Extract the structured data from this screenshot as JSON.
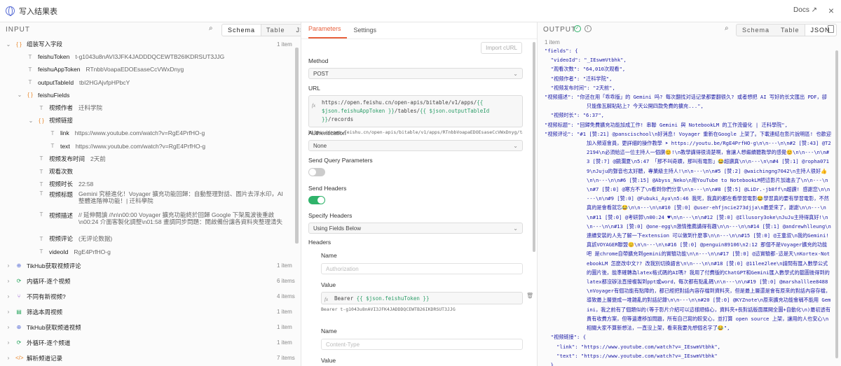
{
  "window": {
    "title": "写入结果表",
    "docs_label": "Docs ↗",
    "close_label": "×"
  },
  "input": {
    "header": "INPUT",
    "views": [
      "Schema",
      "Table",
      "JSON"
    ],
    "active_view": "Schema",
    "tree": [
      {
        "label": "组装写入字段",
        "count": "1 item",
        "icon": "object-icon",
        "level": 0,
        "chev": "⌄"
      },
      {
        "label": "feishuToken",
        "value": "t-g1043u8nAVI3JFK4JADDDQCEWTB26IKDRSUT3JJG",
        "icon": "text-icon",
        "level": 1
      },
      {
        "label": "feishuAppToken",
        "value": "RTnbbVoapaEDOEsaseCcVWxDnyg",
        "icon": "text-icon",
        "level": 1
      },
      {
        "label": "outputTableId",
        "value": "tbI2HGAjvfpHPbcY",
        "icon": "text-icon",
        "level": 1
      },
      {
        "label": "feishuFields",
        "value": "",
        "icon": "object-icon",
        "level": 1,
        "chev": "⌄"
      },
      {
        "label": "视频作者",
        "value": "迁科学院",
        "icon": "text-icon",
        "level": 2
      },
      {
        "label": "视频链接",
        "value": "",
        "icon": "object-icon",
        "level": 2,
        "chev": "⌄"
      },
      {
        "label": "link",
        "value": "https://www.youtube.com/watch?v=RgE4PrfHO-g",
        "icon": "text-icon",
        "level": 3
      },
      {
        "label": "text",
        "value": "https://www.youtube.com/watch?v=RgE4PrfHO-g",
        "icon": "text-icon",
        "level": 3
      },
      {
        "label": "视频发布时间",
        "value": "2天前",
        "icon": "text-icon",
        "level": 2
      },
      {
        "label": "观看次数",
        "value": "",
        "icon": "text-icon",
        "level": 2
      },
      {
        "label": "视频时长",
        "value": "22:58",
        "icon": "text-icon",
        "level": 2
      },
      {
        "label": "视频标题",
        "value": "Gemini 究極進化！Voyager 擴充功能回歸：自動整理對話、圖片去浮水印，AI 整體進階神功能！| 迁科學院",
        "icon": "text-icon",
        "level": 2,
        "tall": true
      },
      {
        "label": "视频描述",
        "value": "// 延伸閱讀 //\\n\\n00:00 Voyager 擴充功能終於回歸 Google 下架風波後重啟\\n00:24 介面客製化調整\\n01:58 畫調同步問題：開啟備份讓各資料夾整理清失\\n02:34...",
        "icon": "text-icon",
        "level": 2,
        "tall": true
      },
      {
        "label": "视频评论",
        "value": "(无评论数据)",
        "icon": "text-icon",
        "level": 2
      },
      {
        "label": "videoId",
        "value": "RgE4PrfHO-g",
        "icon": "text-icon",
        "level": 2
      },
      {
        "label": "TikHub获取视频评论",
        "count": "1 item",
        "icon": "globe-icon",
        "level": 0,
        "chev": "›",
        "top": true
      },
      {
        "label": "内循环-逐个视频",
        "count": "6 items",
        "icon": "loop-icon",
        "level": 0,
        "chev": "›",
        "top": true
      },
      {
        "label": "不同有新视频?",
        "count": "4 items",
        "icon": "branch-icon",
        "level": 0,
        "chev": "›",
        "top": true
      },
      {
        "label": "筛选本周视频",
        "count": "1 item",
        "icon": "filter-icon",
        "level": 0,
        "chev": "›",
        "top": true
      },
      {
        "label": "TikHub获取频道视频",
        "count": "1 item",
        "icon": "globe-icon",
        "level": 0,
        "chev": "›",
        "top": true
      },
      {
        "label": "外循环-逐个频道",
        "count": "1 item",
        "icon": "loop-icon",
        "level": 0,
        "chev": "›",
        "top": true
      },
      {
        "label": "解析频道记录",
        "count": "7 items",
        "icon": "code-icon",
        "level": 0,
        "chev": "›",
        "top": true
      }
    ]
  },
  "params": {
    "tabs": [
      "Parameters",
      "Settings"
    ],
    "active_tab": "Parameters",
    "import_label": "Import cURL",
    "method_label": "Method",
    "method_value": "POST",
    "url_label": "URL",
    "url_expr_a": "https://open.feishu.cn/open-apis/bitable/v1/apps/",
    "url_expr_b": "{{ $json.feishuAppToken }}",
    "url_expr_c": "/tables/",
    "url_expr_d": "{{ $json.outputTableId }}",
    "url_expr_e": "/records",
    "url_preview": "https://open.feishu.cn/open-apis/bitable/v1/apps/RTnbbVoapaEDOEsaseCcVWxDnyg/tables/tbI2HGAjvfpHPbcY/records",
    "auth_label": "Authentication",
    "auth_value": "None",
    "sendq_label": "Send Query Parameters",
    "sendh_label": "Send Headers",
    "spec_label": "Specify Headers",
    "spec_value": "Using Fields Below",
    "headers_label": "Headers",
    "name_label": "Name",
    "name1_placeholder": "Authorization",
    "value_label": "Value",
    "value_expr_a": "Bearer ",
    "value_expr_b": "{{ $json.feishuToken }}",
    "value_preview": "Bearer  t-g1043u8nAVI3JFK4JADDDQCEWTB26IKDRSUT3JJG",
    "name2_label": "Name",
    "name2_placeholder": "Content-Type",
    "value2_label": "Value"
  },
  "output": {
    "header": "OUTPUT",
    "count": "1 item",
    "views": [
      "Schema",
      "Table",
      "JSON"
    ],
    "active_view": "JSON",
    "json_lines": [
      "\"fields\": {",
      "  \"videoId\": \"_IEswmVtbhk\",",
      "  \"观看次数\": \"64,010次观看\",",
      "  \"视频作者\": \"迁科学院\",",
      "  \"视频发布时间\": \"2天前\",",
      "  \"视频描述\": \"你还在用「乖乖版」的 Gemini 吗? 每次翻找对话记录都要翻很久? 或者想把 AI 写好的长文匯出 PDF，卻只能像瓦解貼貼上? 今天公開四款免費的擴充...\",",
      "  \"视频时长\": \"6:37\",",
      "  \"视频标题\": \"回歸免費擴充功能加成工作! 串聯 Gemini 與 NotebookLM 的工作流優化 | 迁科學院\",",
      "  \"视频评论\": \"#1 [赞:21] @panscischool\\n好消息! Voyager 重新在Google 上架了。下載連結在影片說明區! 也歡迎加入頻道會員，更詳細的操作教學 ➤ https://youtu.be/RgE4PrfHO-g\\n\\n---\\n\\n#2 [赞:43] @T22194\\n必須給這一位主持人一個讚😊!\\n教學講得很清楚啊，會讓人想繼續聽教學的感覺😊\\n\\n---\\n\\n#3 [赞:7] @鏡瀾夏\\n5:47 「那不叫奇蹟，那叫有電影」😂超讚真\\n\\n---\\n\\n#4 [赞:1] @ropha0719\\nJuju的聲音也太好聽，專業級主持人!\\n\\n---\\n\\n#5 [赞:2] @waichingng7042\\n主持人很好👍\\n\\n---\\n\\n#6 [赞:15] @Abyss_Neko\\n用YouTube to NotebookLM把這影片加進去了\\n\\n---\\n\\n#7 [赞:0] @寒方不了\\n看到你們分享\\n\\n---\\n\\n#8 [赞:5] @LiDr.-jb8ff\\n超讚! 感謝您\\n\\n---\\n\\n#9 [赞:0] @Fubuki_Aya\\n5:46 我死，我真的都在看學習電影😂學習真的要有學習電影，不然真的是會看就忘😂\\n\\n---\\n\\n#10 [赞:0] @user-ehfjncie273djja\\n最愛來了，謝謝\\n\\n---\\n\\n#11 [赞:0] @考研郭\\n00:24 ♥\\n\\n---\\n\\n#12 [赞:0] @Illusory3oke\\nJuJu主持得真好!\\n\\n---\\n\\n#13 [赞:0] @one-egg\\n激情推薦講得有趣\\n\\n---\\n\\n#14 [赞:1] @andrewhlleung\\n連續安裝的人先了解一下extension 可以做到什麼事\\n\\n---\\n\\n#15 [赞:0] @王童叔\\n我的Gemini! 真該VOYAGER聯盟😊\\n\\n---\\n\\n#16 [赞:0] @penguin89106\\n2:12 那個不是Voyager擴充的功能吧 是chrome自帶擴充到gemini的實驗功能\\n\\n---\\n\\n#17 [赞:0] @這實驗都-這是天\\nKortex-NotebookLM 怎麼改中文?? 改我別切換語言\\n\\n---\\n\\n#18 [赞:0] @11lee2lee\\n請問有匯入數學公式的圖片後，能準確轉為latex格式碼的AI嗎? 我用了付費版的ChatGPT和Gemini匯入數學式的截圖後得到的latex都沒辦法直接複製到ppt或word，每次都有點亂碼\\n\\n---\\n\\n#19 [赞:0] @marshalllee8488\\nVoyager有個功能有點障的，都已經把對話內容存檔到資料夾，但是最上層還是會有原來的對話內容存檔，導致最上層變成一堆雜亂的對話記錄\\n\\n---\\n\\n#20 [赞:0] @KYZnote\\n原來擴充功能會稱不能用 Gemini，我之前有了個類似的(等于影片介紹可以這樣順條心，資料夾+長對話版面展開全圖+自動化\\n)最初透有貴有收費方案，但等邊遭移加問題，所有自己寫的較安心，並打算 open source 上架，讓用的人也安心\\n相關大家不算新想法，一直沒上架，看來我要先想個名字了😂\",",
      "  \"视频链接\": {",
      "    \"link\": \"https://www.youtube.com/watch?v=_IEswmVtbhk\",",
      "    \"text\": \"https://www.youtube.com/watch?v=_IEswmVtbhk\"",
      "  }",
      "},"
    ]
  },
  "colors": {
    "accent": "#e8603c",
    "toggle_on": "#2fb36a",
    "expr": "#2c9d68",
    "string": "#1a1aa6"
  }
}
